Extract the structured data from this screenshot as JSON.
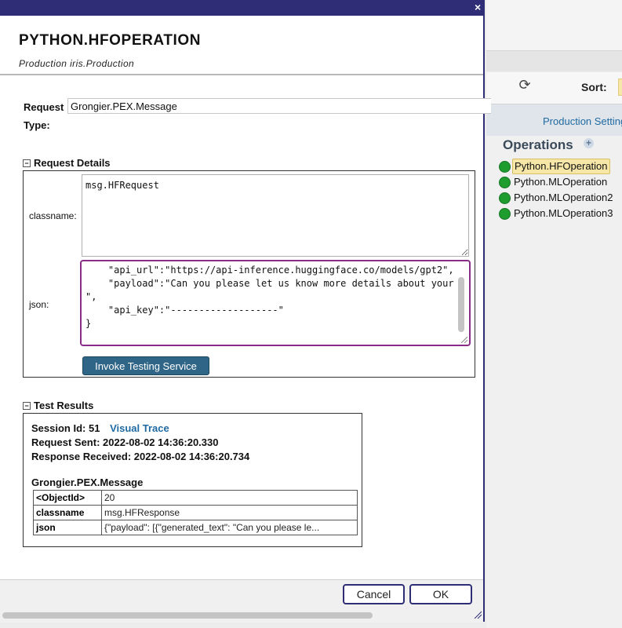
{
  "background": {
    "sort_label": "Sort:",
    "production_settings_label": "Production Settings",
    "operations_title": "Operations",
    "operations": [
      {
        "label": "Python.HFOperation",
        "selected": true
      },
      {
        "label": "Python.MLOperation",
        "selected": false
      },
      {
        "label": "Python.MLOperation2",
        "selected": false
      },
      {
        "label": "Python.MLOperation3",
        "selected": false
      }
    ],
    "status_color": "#1e9c2e",
    "selected_color": "#f6e7a8"
  },
  "dialog": {
    "close_label": "×",
    "title": "PYTHON.HFOPERATION",
    "subtitle": "Production iris.Production",
    "request_type_label_line1": "Request",
    "request_type_label_line2": "Type:",
    "request_type_value": "Grongier.PEX.Message",
    "request_details_header": "Request Details",
    "classname_label": "classname:",
    "classname_value": "msg.HFRequest",
    "json_label": "json:",
    "json_value": "    \"api_url\":\"https://api-inference.huggingface.co/models/gpt2\",\n    \"payload\":\"Can you please let us know more details about your \",\n    \"api_key\":\"-------------------\"\n}",
    "invoke_button": "Invoke Testing Service",
    "test_results_header": "Test Results",
    "results": {
      "session_label": "Session Id:",
      "session_id": "51",
      "visual_trace": "Visual Trace",
      "request_sent_label": "Request Sent:",
      "request_sent": "2022-08-02 14:36:20.330",
      "response_received_label": "Response Received:",
      "response_received": "2022-08-02 14:36:20.734",
      "message_class": "Grongier.PEX.Message",
      "rows": [
        {
          "key": "<ObjectId>",
          "value": "20"
        },
        {
          "key": "classname",
          "value": "msg.HFResponse"
        },
        {
          "key": "json",
          "value": "{\"payload\": [{\"generated_text\": \"Can you please le..."
        }
      ]
    },
    "cancel_button": "Cancel",
    "ok_button": "OK",
    "accent_color": "#2e2d76",
    "invoke_color": "#2f6587"
  }
}
